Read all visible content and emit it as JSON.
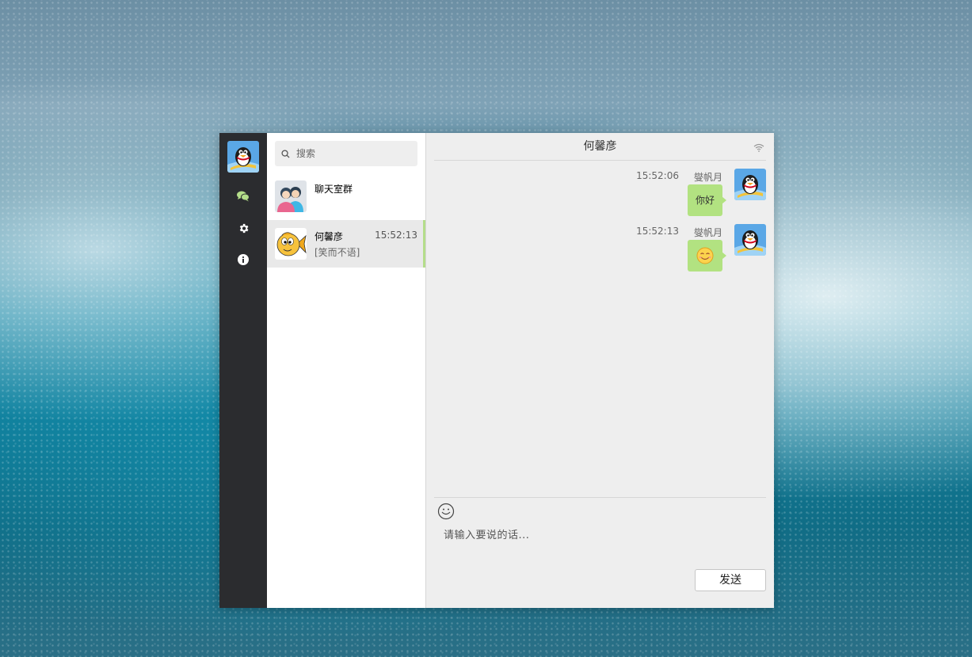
{
  "user": {
    "name": "燮帆月",
    "avatar_icon": "qq-penguin-avatar"
  },
  "nav": {
    "items": [
      {
        "name": "chat",
        "icon": "chat-bubbles-icon",
        "color": "#b4dd8a",
        "active": true
      },
      {
        "name": "settings",
        "icon": "gear-icon",
        "color": "#ffffff"
      },
      {
        "name": "about",
        "icon": "info-icon",
        "color": "#ffffff"
      }
    ]
  },
  "search": {
    "placeholder": "搜索"
  },
  "sessions": [
    {
      "name": "聊天室群",
      "time": "",
      "last": "",
      "avatar_icon": "group-avatar"
    },
    {
      "name": "何馨彦",
      "time": "15:52:13",
      "last": "[笑而不语]",
      "avatar_icon": "fish-avatar",
      "active": true
    }
  ],
  "chat": {
    "title": "何馨彦",
    "messages": [
      {
        "time": "15:52:06",
        "user": "燮帆月",
        "text": "你好",
        "type": "text"
      },
      {
        "time": "15:52:13",
        "user": "燮帆月",
        "text": "",
        "type": "emoji",
        "emoji_icon": "smile-emoji-icon"
      }
    ],
    "input_placeholder": "请输入要说的话...",
    "send_label": "发送"
  },
  "colors": {
    "accent": "#b4dd8a",
    "bubble": "#b2e281",
    "nav_bg": "#2b2c2f"
  }
}
